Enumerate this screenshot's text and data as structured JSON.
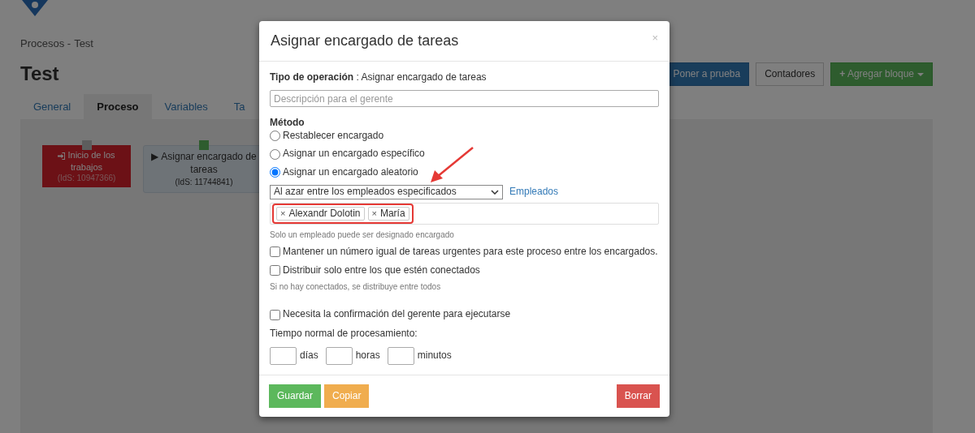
{
  "page": {
    "breadcrumb": [
      "Procesos -",
      "Test"
    ],
    "title": "Test",
    "tabs": [
      {
        "label": "General",
        "selected": false
      },
      {
        "label": "Proceso",
        "selected": true
      },
      {
        "label": "Variables",
        "selected": false
      },
      {
        "label": "Ta",
        "selected": false
      }
    ],
    "toolbar_buttons": [
      {
        "label": "Poner a prueba",
        "kind": "primary",
        "caret": false
      },
      {
        "label": "Contadores",
        "kind": "default",
        "caret": false
      },
      {
        "label": "Agregar bloque",
        "kind": "success",
        "caret": true,
        "icon": "+"
      }
    ],
    "nodes": [
      {
        "kind": "start",
        "title": "Inicio de los trabajos",
        "id_text": "(IdS: 10947366)"
      },
      {
        "kind": "task",
        "icon": "▶",
        "title": "Asignar encargado de tareas",
        "id_text": "(IdS: 11744841)"
      }
    ]
  },
  "modal": {
    "title": "Asignar encargado de tareas",
    "close": "×",
    "operation_label": "Tipo de operación",
    "operation_value": " : Asignar encargado de tareas",
    "description_placeholder": "Descripción para el gerente",
    "method_label": "Método",
    "methods": [
      {
        "label": "Restablecer encargado",
        "selected": false
      },
      {
        "label": "Asignar un encargado específico",
        "selected": false
      },
      {
        "label": "Asignar un encargado aleatorio",
        "selected": true
      }
    ],
    "select_value": "Al azar entre los empleados especificados",
    "employees_link": "Empleados",
    "tags": [
      {
        "remove": "×",
        "name": "Alexandr Dolotin"
      },
      {
        "remove": "×",
        "name": "María"
      }
    ],
    "tags_hint": "Solo un empleado puede ser designado encargado",
    "options": [
      {
        "label": "Mantener un número igual de tareas urgentes para este proceso entre los encargados.",
        "checked": false
      },
      {
        "label": "Distribuir solo entre los que estén conectados",
        "checked": false,
        "hint": "Si no hay conectados, se distribuye entre todos"
      },
      {
        "label": "Necesita la confirmación del gerente para ejecutarse",
        "checked": false
      }
    ],
    "time_label": "Tiempo normal de procesamiento:",
    "time_units": [
      "días",
      "horas",
      "minutos"
    ],
    "buttons": [
      {
        "label": "Guardar",
        "kind": "save"
      },
      {
        "label": "Copiar",
        "kind": "copy"
      },
      {
        "label": "Borrar",
        "kind": "delete"
      }
    ]
  }
}
